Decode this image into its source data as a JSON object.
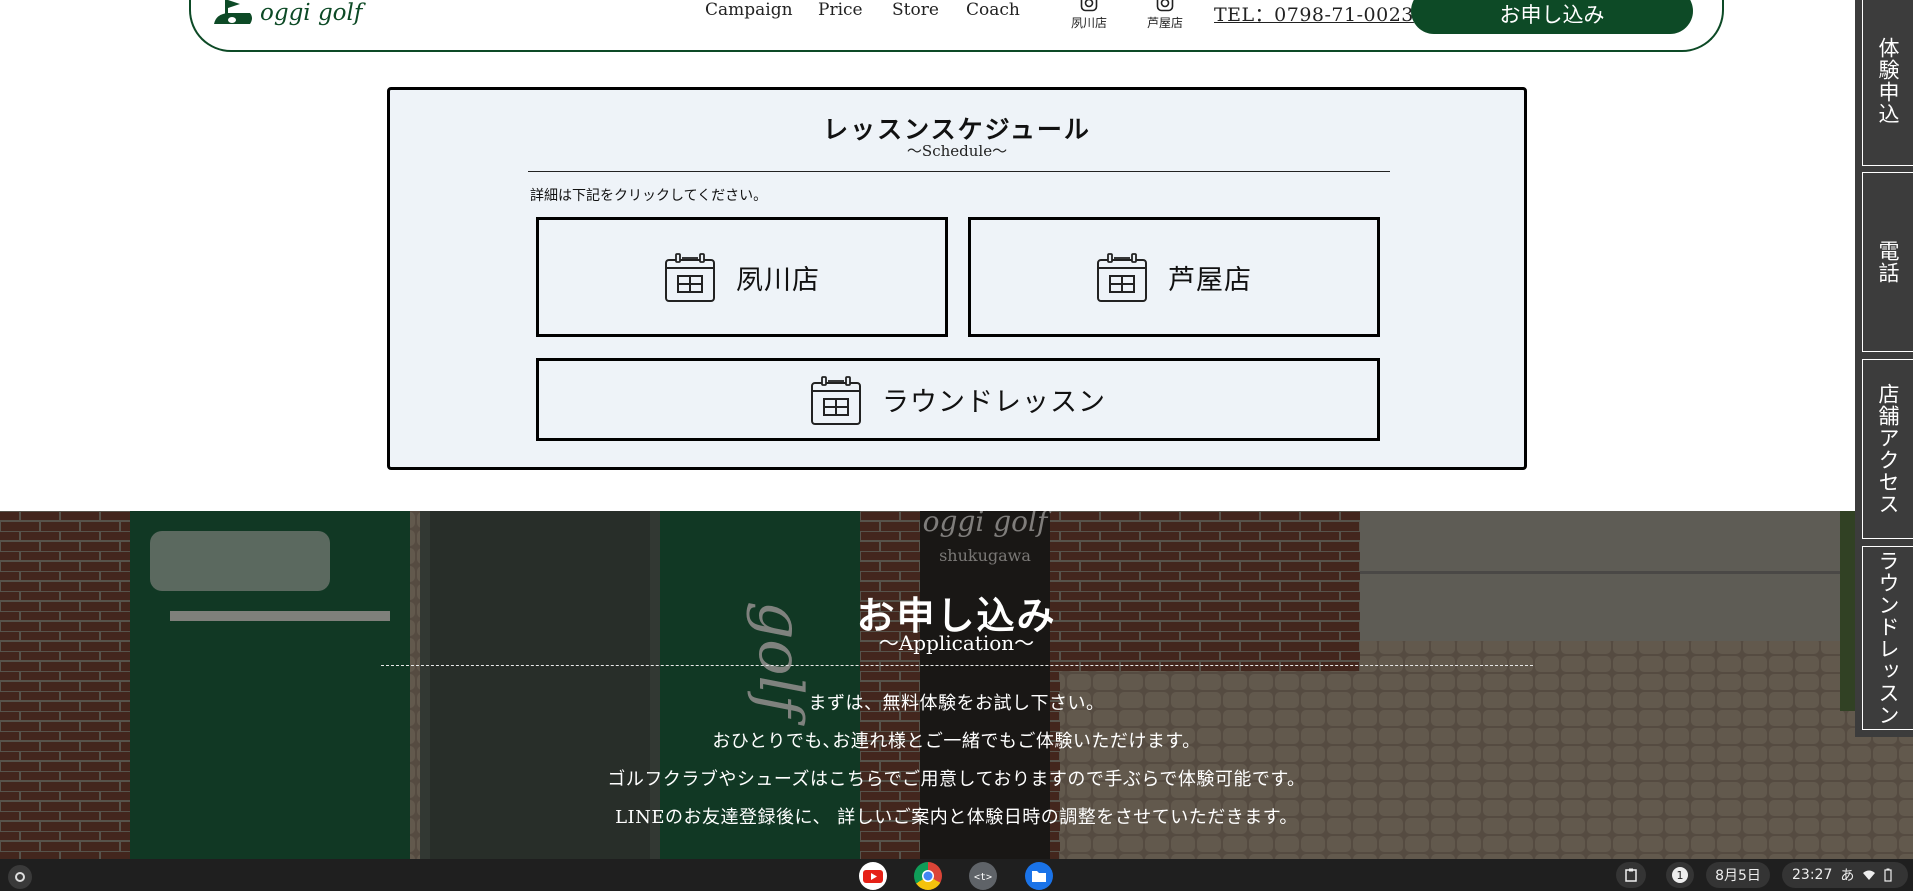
{
  "header": {
    "logo_text": "oggi golf",
    "nav": [
      "Campaign",
      "Price",
      "Store",
      "Coach"
    ],
    "instagram": [
      "夙川店",
      "芦屋店"
    ],
    "tel": "TEL：0798-71-0023",
    "apply_label": "お申し込み",
    "brand_color": "#0d4a26"
  },
  "schedule": {
    "title": "レッスンスケジュール",
    "subtitle": "〜Schedule〜",
    "note": "詳細は下記をクリックしてください。",
    "buttons": [
      "夙川店",
      "芦屋店",
      "ラウンドレッスン"
    ],
    "icon": "calendar-icon"
  },
  "application": {
    "title": "お申し込み",
    "subtitle": "〜Application〜",
    "paragraphs": [
      "まずは、無料体験をお試し下さい。",
      "おひとりでも､お連れ様とご一緒でもご体験いただけます。",
      "ゴルフクラブやシューズはこちらでご用意しておりますので手ぶらで体験可能です。",
      "LINEのお友達登録後に、 詳しいご案内と体験日時の調整をさせていただきます。"
    ],
    "photo_signage": [
      "oggi golf",
      "shukugawa",
      "golf"
    ]
  },
  "side_tabs": [
    "体験申込",
    "電話",
    "店舗アクセス",
    "ラウンドレッスン"
  ],
  "taskbar": {
    "apps": [
      "youtube-icon",
      "chrome-icon",
      "text-editor-icon",
      "files-icon"
    ],
    "notification_count": "1",
    "date": "8月5日",
    "time": "23:27",
    "ime": "あ"
  }
}
